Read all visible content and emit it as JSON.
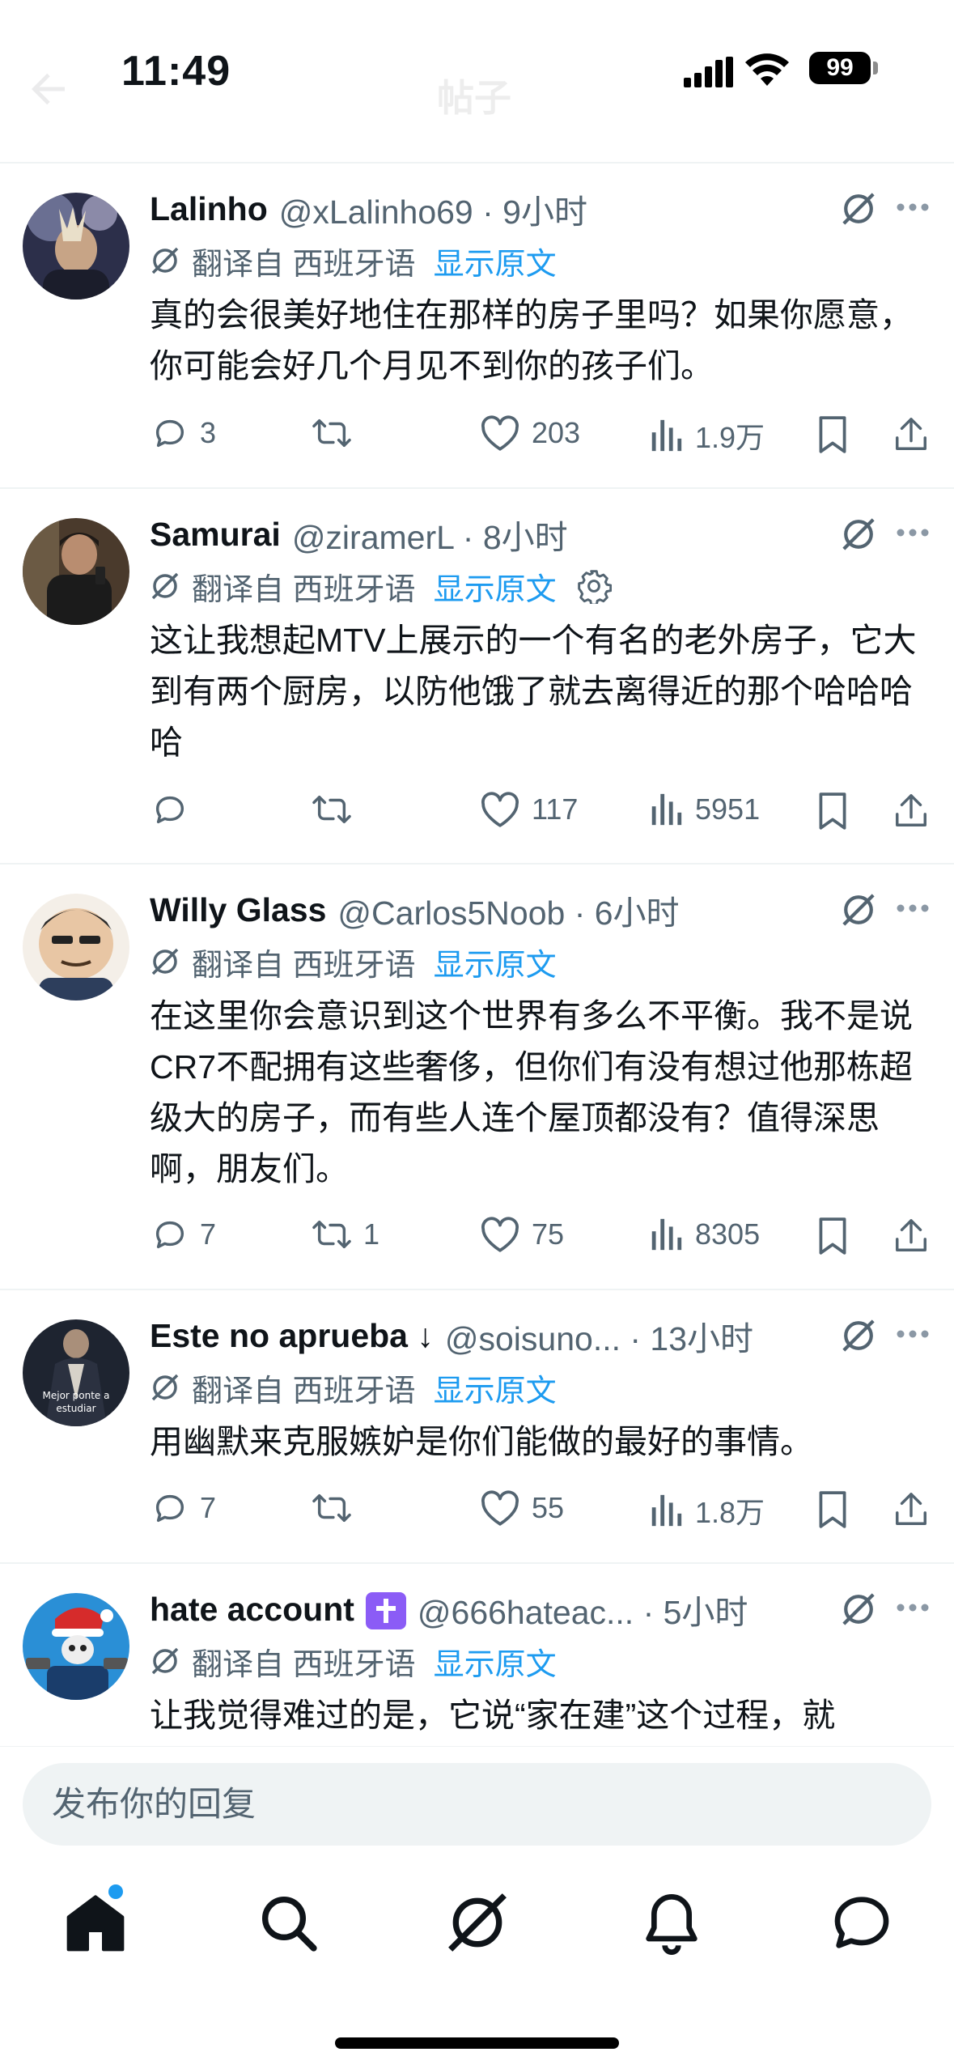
{
  "status_bar": {
    "time": "11:49",
    "battery": "99"
  },
  "header": {
    "title": "帖子"
  },
  "translate_prefix": "翻译自 西班牙语",
  "show_original": "显示原文",
  "tweets": [
    {
      "name": "Lalinho",
      "handle": "@xLalinho69 · 9小时",
      "text": "真的会很美好地住在那样的房子里吗？如果你愿意，你可能会好几个月见不到你的孩子们。",
      "replies": "3",
      "retweets": "",
      "likes": "203",
      "views": "1.9万"
    },
    {
      "name": "Samurai",
      "handle": "@ziramerL · 8小时",
      "text": "这让我想起MTV上展示的一个有名的老外房子，它大到有两个厨房，以防他饿了就去离得近的那个哈哈哈哈",
      "replies": "",
      "retweets": "",
      "likes": "117",
      "views": "5951"
    },
    {
      "name": "Willy Glass",
      "handle": "@Carlos5Noob · 6小时",
      "text": "在这里你会意识到这个世界有多么不平衡。我不是说CR7不配拥有这些奢侈，但你们有没有想过他那栋超级大的房子，而有些人连个屋顶都没有？值得深思啊，朋友们。",
      "replies": "7",
      "retweets": "1",
      "likes": "75",
      "views": "8305"
    },
    {
      "name": "Este no aprueba ↓",
      "handle": "@soisuno... · 13小时",
      "text": "用幽默来克服嫉妒是你们能做的最好的事情。",
      "avatar_caption": "Mejor ponte a estudiar",
      "replies": "7",
      "retweets": "",
      "likes": "55",
      "views": "1.8万"
    },
    {
      "name": "hate account",
      "handle": "@666hateac... · 5小时",
      "text": "让我觉得难过的是，它说“家在建”这个过程，就",
      "replies": "",
      "retweets": "",
      "likes": "",
      "views": ""
    }
  ],
  "reply": {
    "placeholder": "发布你的回复"
  },
  "tabs": [
    "home-icon",
    "search-icon",
    "grok-icon",
    "notifications-icon",
    "messages-icon"
  ],
  "colors": {
    "accent": "#1d9bf0",
    "text": "#0f1419",
    "muted": "#536471",
    "divider": "#eff3f4"
  }
}
